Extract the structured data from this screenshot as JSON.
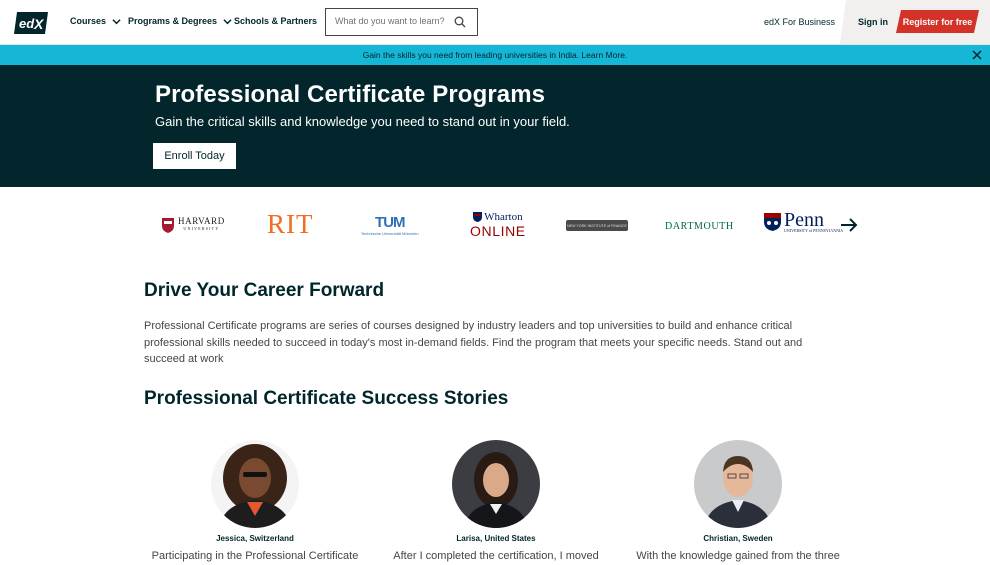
{
  "header": {
    "logo": "edX",
    "nav": [
      {
        "label": "Courses",
        "dropdown": true
      },
      {
        "label": "Programs & Degrees",
        "dropdown": true
      },
      {
        "label": "Schools & Partners",
        "dropdown": false
      }
    ],
    "search_placeholder": "What do you want to learn?",
    "business_label": "edX For Business",
    "signin_label": "Sign in",
    "register_label": "Register for free"
  },
  "banner": {
    "text": "Gain the skills you need from leading universities in India. Learn More.",
    "color": "#15b6d6"
  },
  "hero": {
    "title": "Professional Certificate Programs",
    "subtitle": "Gain the critical skills and knowledge you need to stand out in your field.",
    "cta": "Enroll Today",
    "background": "#02262b"
  },
  "partners": {
    "harvard": "HARVARD",
    "harvard_sub": "UNIVERSITY",
    "rit": "RIT",
    "tum_mark": "TUM",
    "tum_caption": "Technische Universität München",
    "wharton_top": "Wharton",
    "wharton_bottom": "ONLINE",
    "nyif": "NEW YORK INSTITUTE of FINANCE",
    "dartmouth": "DARTMOUTH",
    "penn": "Penn",
    "penn_sub": "UNIVERSITY of PENNSYLVANIA"
  },
  "career": {
    "heading": "Drive Your Career Forward",
    "body": "Professional Certificate programs are series of courses designed by industry leaders and top universities to build and enhance critical professional skills needed to succeed in today's most in-demand fields. Find the program that meets your specific needs. Stand out and succeed at work"
  },
  "stories": {
    "heading": "Professional Certificate Success Stories",
    "items": [
      {
        "name": "Jessica, Switzerland",
        "quote": "Participating in the Professional Certificate"
      },
      {
        "name": "Larisa, United States",
        "quote": "After I completed the certification, I moved"
      },
      {
        "name": "Christian, Sweden",
        "quote": "With the knowledge gained from the three"
      }
    ]
  }
}
